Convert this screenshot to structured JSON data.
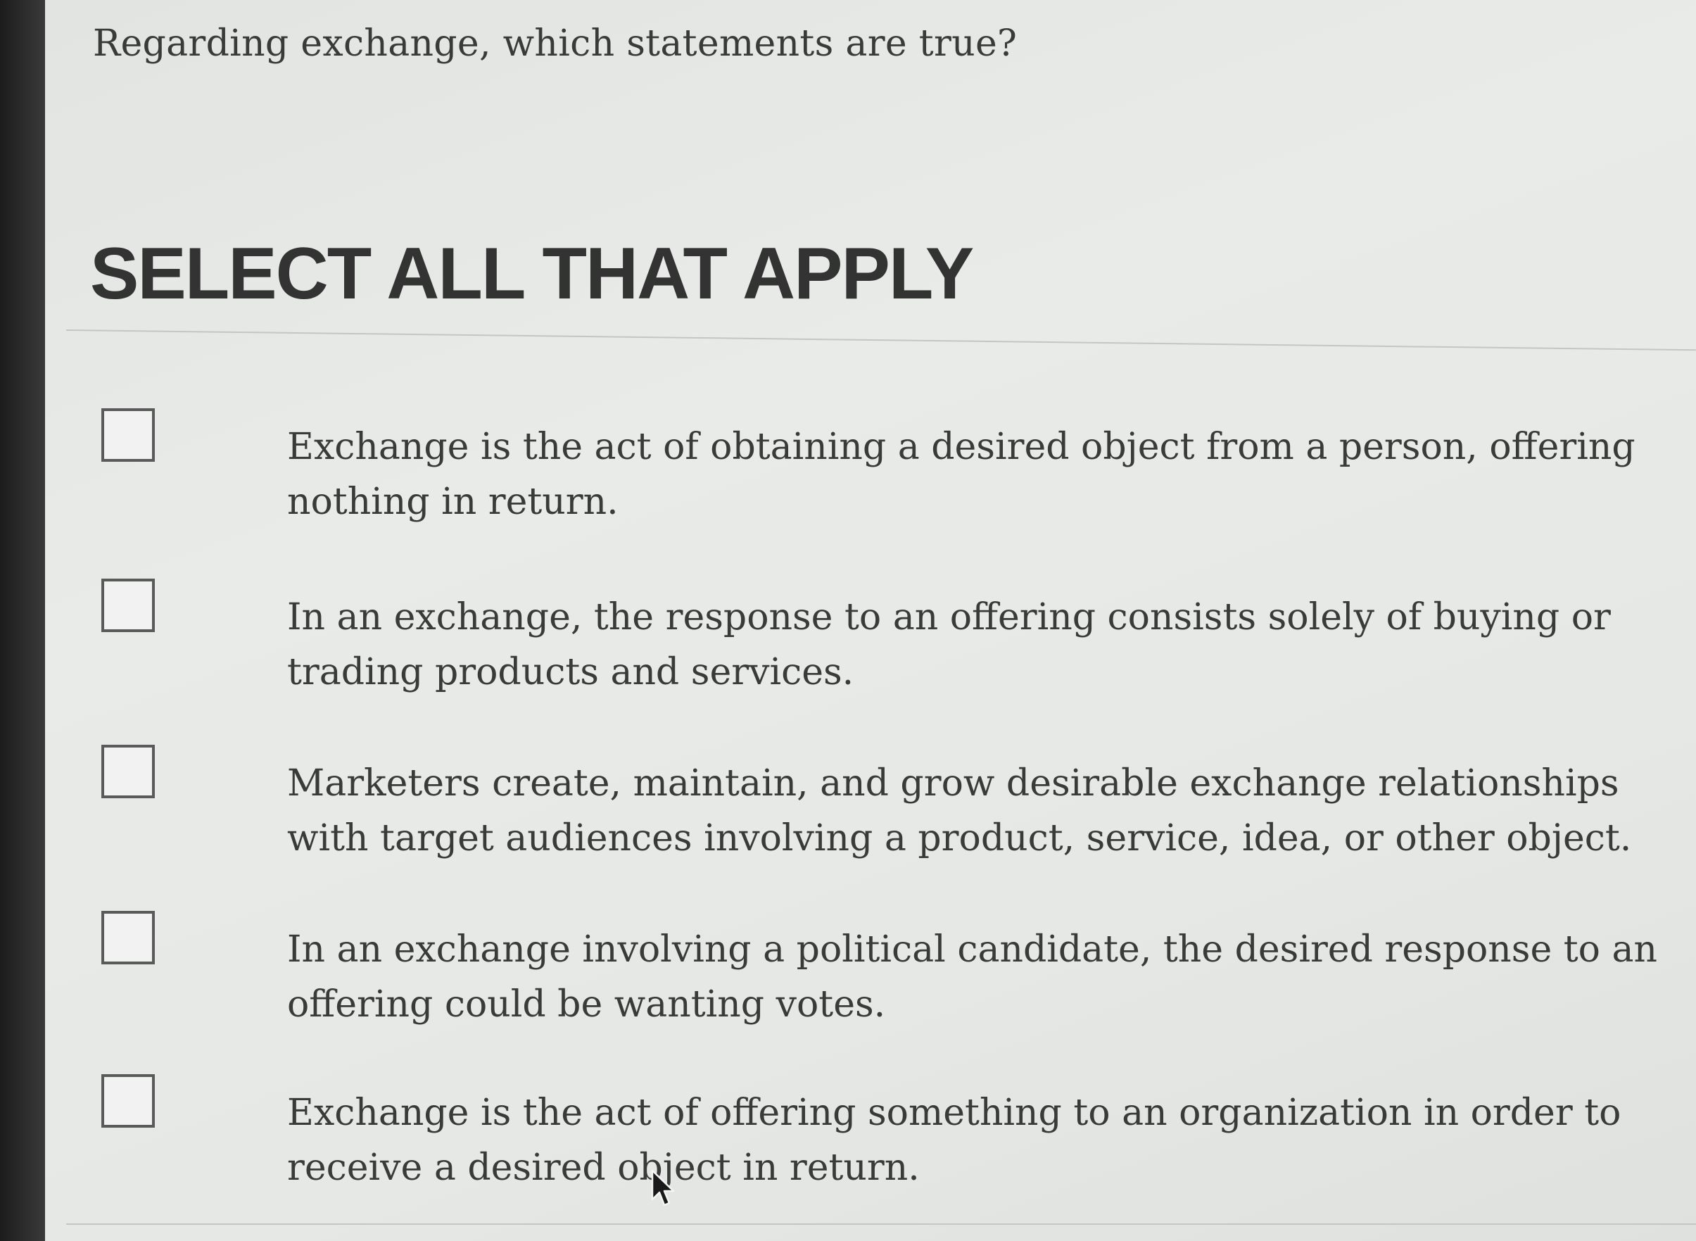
{
  "question": {
    "text": "Regarding exchange, which statements are true?"
  },
  "instruction": {
    "text": "SELECT ALL THAT APPLY"
  },
  "options": [
    {
      "text": "Exchange is the act of obtaining a desired object from a person, offering nothing in return.",
      "checked": false
    },
    {
      "text": "In an exchange, the response to an offering consists solely of buying or trading products and services.",
      "checked": false
    },
    {
      "text": "Marketers create, maintain, and grow desirable exchange relationships with target audiences involving a product, service, idea, or other object.",
      "checked": false
    },
    {
      "text": "In an exchange involving a political candidate, the desired response to an offering could be wanting votes.",
      "checked": false
    },
    {
      "text": "Exchange is the act of offering something to an organization in order to receive a desired object in return.",
      "checked": false
    }
  ],
  "icons": {
    "checkbox": "empty-square-checkbox-icon",
    "cursor": "mouse-pointer-icon"
  },
  "colors": {
    "text": "#3a3a3a",
    "heading": "#333333",
    "background": "#e7e9e7",
    "checkbox_border": "#5a5a5a"
  }
}
